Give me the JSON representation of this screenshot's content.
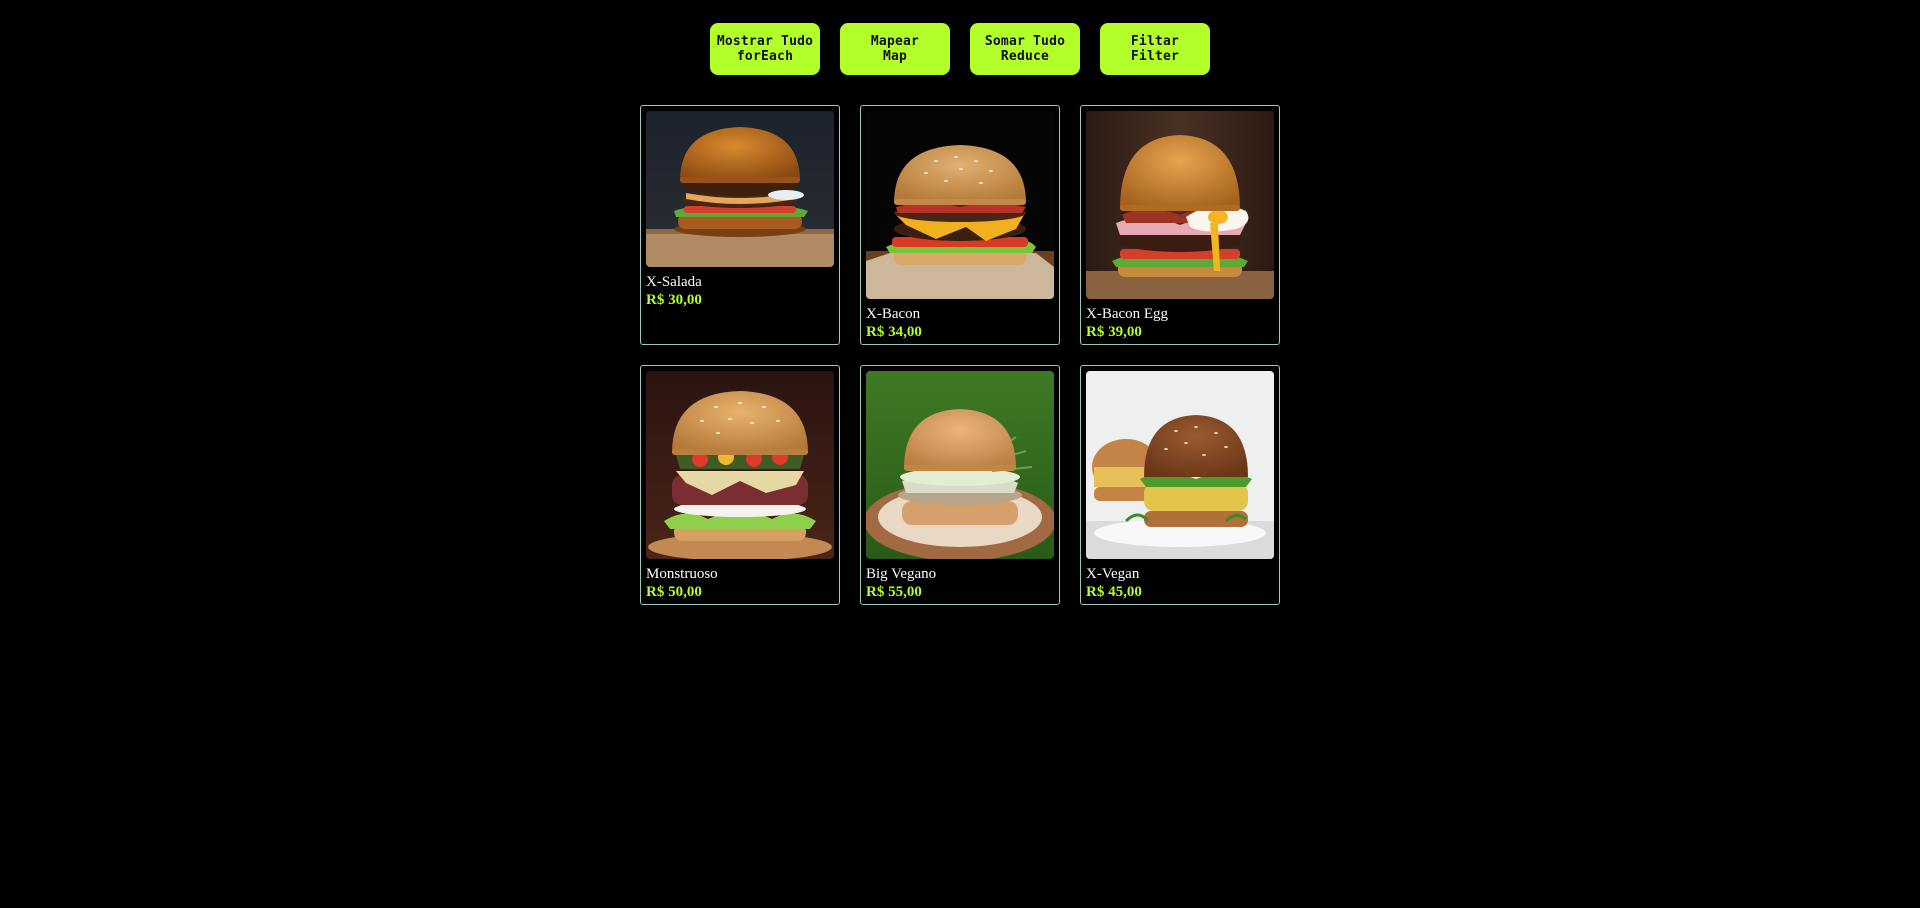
{
  "toolbar": {
    "buttons": [
      {
        "line1": "Mostrar Tudo",
        "line2": "forEach"
      },
      {
        "line1": "Mapear",
        "line2": "Map"
      },
      {
        "line1": "Somar Tudo",
        "line2": "Reduce"
      },
      {
        "line1": "Filtar",
        "line2": "Filter"
      }
    ]
  },
  "colors": {
    "background": "#000000",
    "accent": "#b2ff2a",
    "card_border": "#9ec7c2",
    "text": "#ffffff"
  },
  "menu": {
    "items": [
      {
        "name": "X-Salada",
        "price": "R$ 30,00",
        "image": "burger-xsalada-image"
      },
      {
        "name": "X-Bacon",
        "price": "R$ 34,00",
        "image": "burger-xbacon-image"
      },
      {
        "name": "X-Bacon Egg",
        "price": "R$ 39,00",
        "image": "burger-xbaconegg-image"
      },
      {
        "name": "Monstruoso",
        "price": "R$ 50,00",
        "image": "burger-monstruoso-image"
      },
      {
        "name": "Big Vegano",
        "price": "R$ 55,00",
        "image": "burger-bigvegano-image"
      },
      {
        "name": "X-Vegan",
        "price": "R$ 45,00",
        "image": "burger-xvegan-image"
      }
    ]
  }
}
